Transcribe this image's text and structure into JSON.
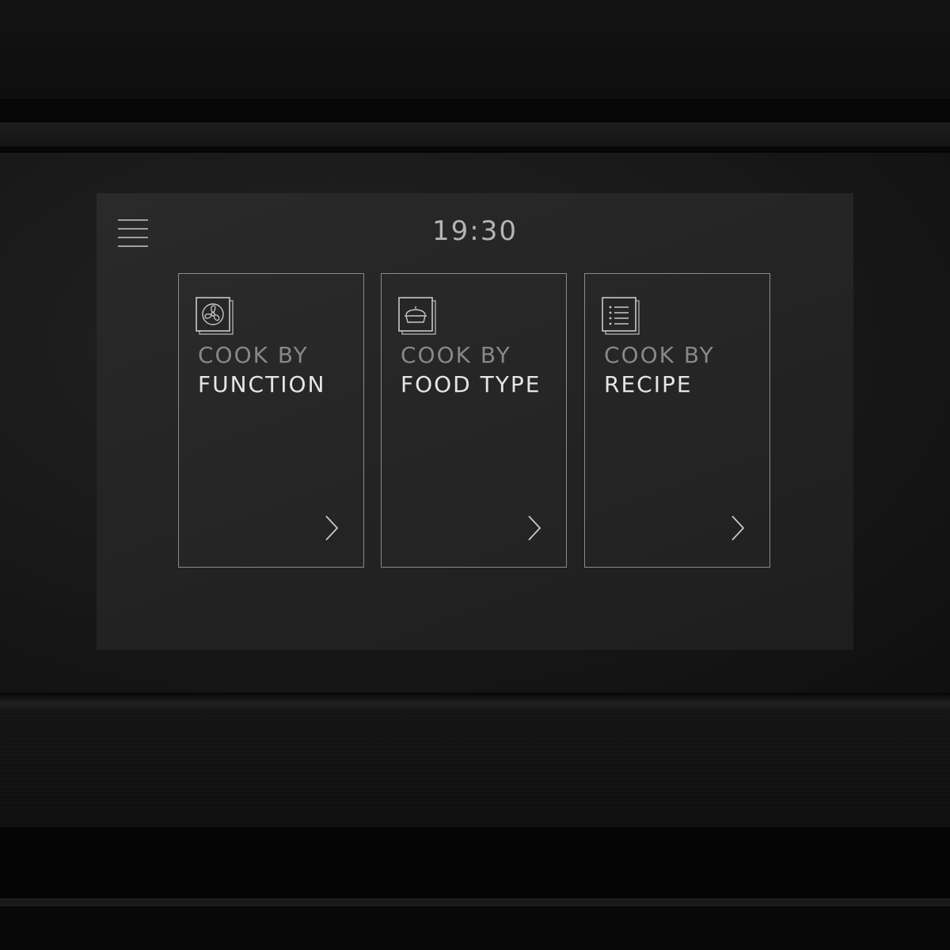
{
  "status": {
    "time": "19:30"
  },
  "menu": {
    "icon": "hamburger-menu-icon"
  },
  "cards": [
    {
      "line1": "COOK BY",
      "line2": "FUNCTION",
      "icon": "fan-function-icon"
    },
    {
      "line1": "COOK BY",
      "line2": "FOOD TYPE",
      "icon": "food-dish-icon"
    },
    {
      "line1": "COOK BY",
      "line2": "RECIPE",
      "icon": "recipe-list-icon"
    }
  ],
  "colors": {
    "card_border": "#8a8a8a",
    "label_primary": "#e6e6e6",
    "label_secondary": "#888888",
    "screen_bg": "#262626"
  }
}
